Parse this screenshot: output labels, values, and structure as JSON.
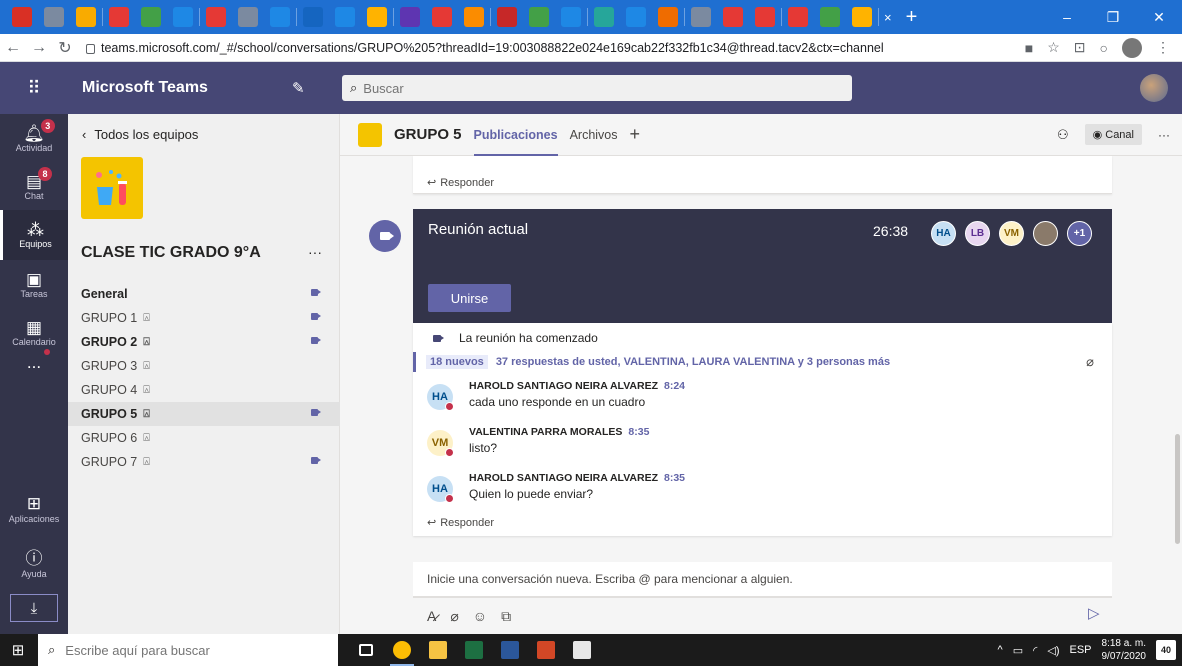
{
  "browser": {
    "url": "teams.microsoft.com/_#/school/conversations/GRUPO%205?threadId=19:003088822e024e169cab22f332fb1c34@thread.tacv2&ctx=channel",
    "tab_close": "×",
    "new_tab": "+",
    "tab_icon_colors": [
      "#d93025",
      "#7b8aa0",
      "#f9ab00",
      "#e53935",
      "#43a047",
      "#1e88e5",
      "#e53935",
      "#7b8aa0",
      "#1e88e5",
      "#1565c0",
      "#1e88e5",
      "#ffb300",
      "#5e35b1",
      "#e53935",
      "#fb8c00",
      "#c62828",
      "#43a047",
      "#1e88e5",
      "#26a69a",
      "#1e88e5",
      "#ef6c00",
      "#7b8aa0",
      "#e53935",
      "#e53935",
      "#e53935",
      "#43a047",
      "#ffb300",
      "#43a047",
      "#e53935",
      "#fb8c00",
      "#fdd835",
      "#7b8aa0",
      "#6d4c41",
      "#e53935",
      "#1e88e5",
      "#f4511e"
    ]
  },
  "teams": {
    "app_name": "Microsoft Teams",
    "search_placeholder": "Buscar",
    "rail": {
      "activity": {
        "label": "Actividad",
        "badge": "3"
      },
      "chat": {
        "label": "Chat",
        "badge": "8"
      },
      "teams": {
        "label": "Equipos"
      },
      "assignments": {
        "label": "Tareas"
      },
      "calendar": {
        "label": "Calendario"
      },
      "more": {
        "label": "..."
      },
      "apps": {
        "label": "Aplicaciones"
      },
      "help": {
        "label": "Ayuda"
      }
    },
    "sidebar": {
      "back_label": "Todos los equipos",
      "team_name": "CLASE TIC GRADO 9°A",
      "more": "···",
      "channels": [
        {
          "name": "General",
          "bold": true,
          "private": false,
          "meeting": true,
          "active": false
        },
        {
          "name": "GRUPO 1",
          "bold": false,
          "private": true,
          "meeting": true,
          "active": false
        },
        {
          "name": "GRUPO 2",
          "bold": true,
          "private": true,
          "meeting": true,
          "active": false
        },
        {
          "name": "GRUPO 3",
          "bold": false,
          "private": true,
          "meeting": false,
          "active": false
        },
        {
          "name": "GRUPO 4",
          "bold": false,
          "private": true,
          "meeting": false,
          "active": false
        },
        {
          "name": "GRUPO 5",
          "bold": true,
          "private": true,
          "meeting": true,
          "active": true
        },
        {
          "name": "GRUPO 6",
          "bold": false,
          "private": true,
          "meeting": false,
          "active": false
        },
        {
          "name": "GRUPO 7",
          "bold": false,
          "private": true,
          "meeting": true,
          "active": false
        }
      ]
    },
    "channel_header": {
      "name": "GRUPO 5",
      "tabs": [
        "Publicaciones",
        "Archivos"
      ],
      "add_tab": "+",
      "canal_label": "Canal",
      "more": "···"
    },
    "prev_reply": "Responder",
    "meeting": {
      "title": "Reunión actual",
      "elapsed": "26:38",
      "join_label": "Unirse",
      "participants": [
        {
          "initials": "HA",
          "bg": "#c7e0f4",
          "fg": "#004e8c"
        },
        {
          "initials": "LB",
          "bg": "#e8d7f0",
          "fg": "#5c2e91"
        },
        {
          "initials": "VM",
          "bg": "#fdf1c8",
          "fg": "#8a6200"
        },
        {
          "initials": "",
          "bg": "#8a7a6a",
          "fg": "#fff"
        },
        {
          "initials": "+1",
          "bg": "#6264a7",
          "fg": "#fff"
        }
      ]
    },
    "thread": {
      "started_text": "La reunión ha comenzado",
      "new_count": "18 nuevos",
      "replies_summary": "37 respuestas de usted, VALENTINA, LAURA VALENTINA y 3 personas más",
      "messages": [
        {
          "initials": "HA",
          "av_bg": "#c7e0f4",
          "av_fg": "#004e8c",
          "author": "HAROLD SANTIAGO NEIRA ALVAREZ",
          "time": "8:24",
          "text": "cada uno responde en un cuadro"
        },
        {
          "initials": "VM",
          "av_bg": "#fdf1c8",
          "av_fg": "#8a6200",
          "author": "VALENTINA PARRA MORALES",
          "time": "8:35",
          "text": "listo?"
        },
        {
          "initials": "HA",
          "av_bg": "#c7e0f4",
          "av_fg": "#004e8c",
          "author": "HAROLD SANTIAGO NEIRA ALVAREZ",
          "time": "8:35",
          "text": "Quien lo puede enviar?"
        }
      ],
      "reply_label": "Responder"
    },
    "compose_placeholder": "Inicie una conversación nueva. Escriba @ para mencionar a alguien."
  },
  "taskbar": {
    "search_placeholder": "Escribe aquí para buscar",
    "language": "ESP",
    "time": "8:18 a. m.",
    "date": "9/07/2020",
    "notifications": "40",
    "apps": [
      {
        "name": "task-view",
        "color": "#1b1b1b",
        "open": false
      },
      {
        "name": "chrome",
        "color": "#fbbc04",
        "open": true
      },
      {
        "name": "file-explorer",
        "color": "#f6c343",
        "open": false
      },
      {
        "name": "excel",
        "color": "#1d6f42",
        "open": false
      },
      {
        "name": "word",
        "color": "#2b579a",
        "open": false
      },
      {
        "name": "powerpoint",
        "color": "#d24726",
        "open": false
      },
      {
        "name": "acrobat",
        "color": "#e7e7e7",
        "open": false
      }
    ]
  },
  "colors": {
    "teams_purple": "#6264a7",
    "header": "#464775",
    "rail": "#33344a",
    "chrome_blue": "#1f6fd1"
  }
}
